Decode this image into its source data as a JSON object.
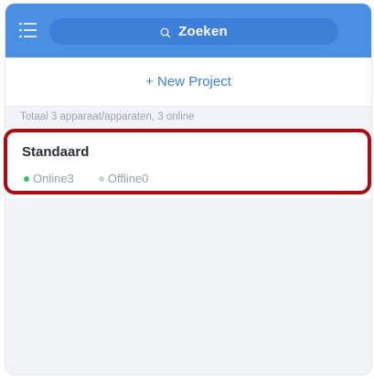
{
  "header": {
    "search_label": "Zoeken",
    "menu_icon": "menu-list-icon",
    "search_icon": "search-icon",
    "background_color": "#4b8fe3"
  },
  "actions": {
    "new_project_label": "+ New Project"
  },
  "summary": {
    "text": "Totaal 3 apparaat/apparaten, 3 online"
  },
  "groups": [
    {
      "name": "Standaard",
      "online_label": "Online3",
      "offline_label": "Offline0",
      "online_color": "#3fbf6a",
      "offline_color": "#cfd3d8"
    }
  ],
  "highlight_color": "#a90f12"
}
